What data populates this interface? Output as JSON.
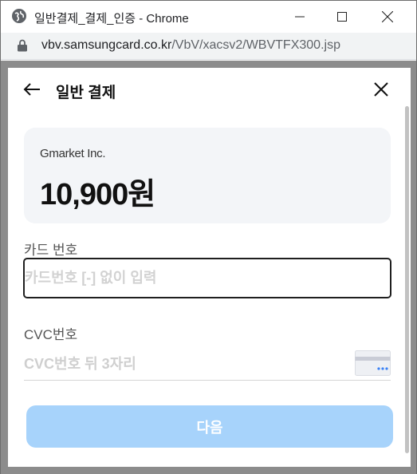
{
  "window": {
    "title": "일반결제_결제_인증 - Chrome"
  },
  "urlbar": {
    "host": "vbv.samsungcard.co.kr",
    "path": "/VbV/xacsv2/WBVTFX300.jsp"
  },
  "modal": {
    "title": "일반 결제",
    "merchant": "Gmarket Inc.",
    "amount": "10,900원",
    "card_number": {
      "label": "카드 번호",
      "placeholder": "카드번호 [-] 없이 입력",
      "value": ""
    },
    "cvc": {
      "label": "CVC번호",
      "placeholder": "CVC번호 뒤 3자리",
      "value": ""
    },
    "next_button": "다음"
  },
  "icons": {
    "app": "globe-icon",
    "lock": "lock-icon",
    "back": "arrow-left-icon",
    "close": "close-icon",
    "cvc": "credit-card-icon"
  },
  "colors": {
    "primary_disabled": "#a7d3fb",
    "card_bg": "#f3f5f8",
    "input_border": "#1f1f1f"
  }
}
